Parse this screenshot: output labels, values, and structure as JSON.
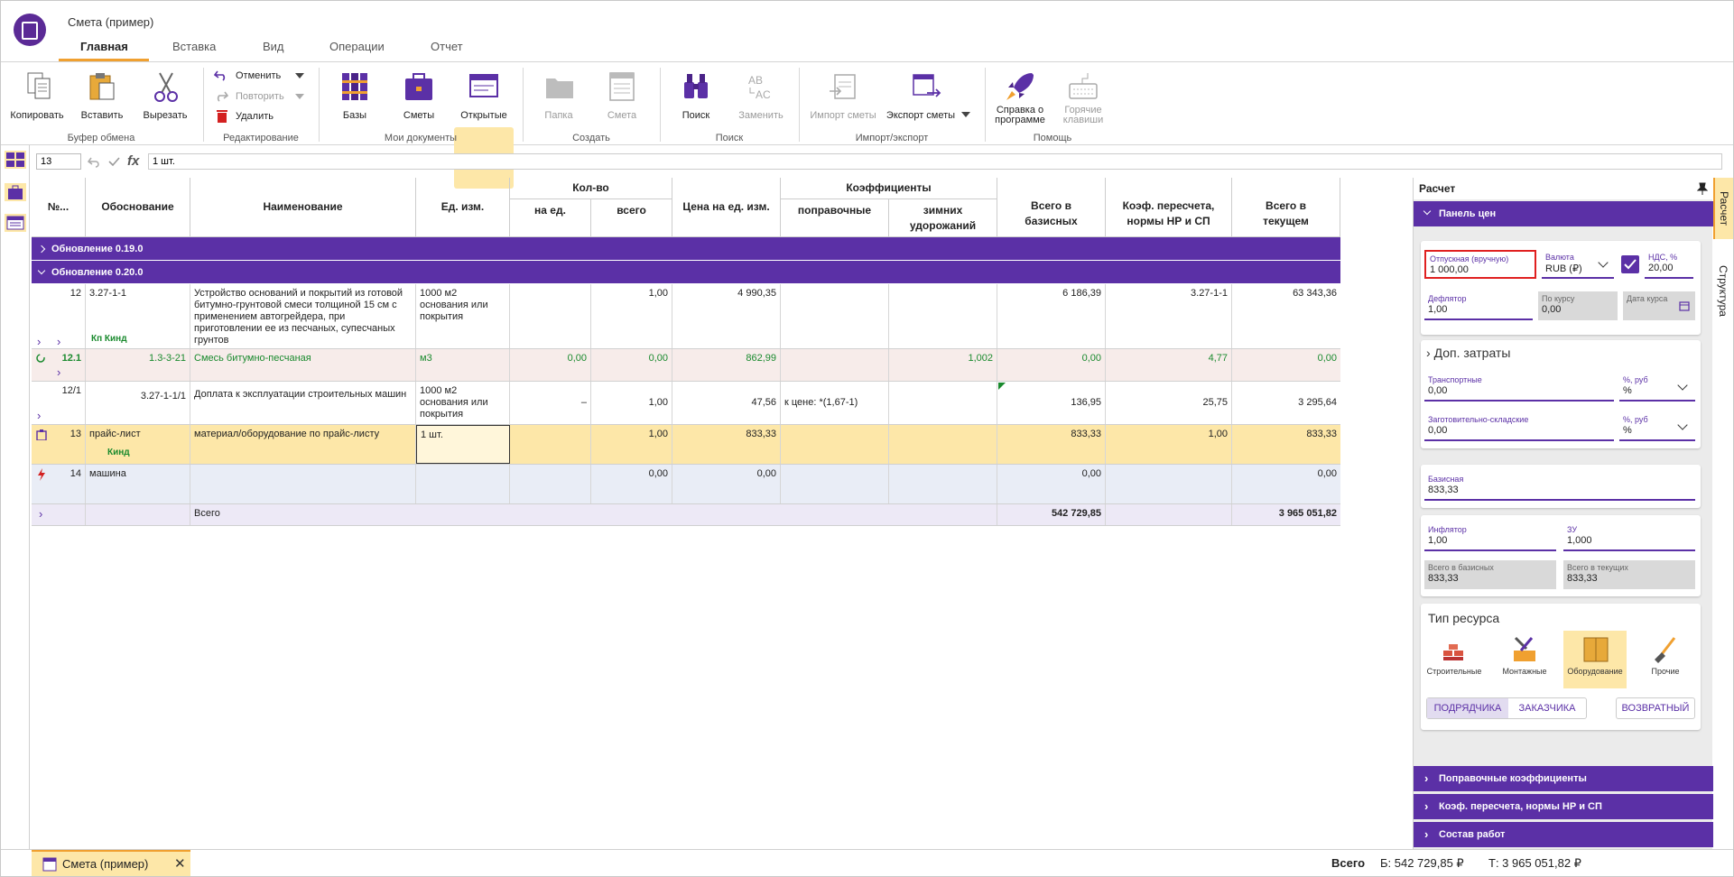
{
  "app": {
    "title": "Смета (пример)",
    "tabs": [
      "Главная",
      "Вставка",
      "Вид",
      "Операции",
      "Отчет"
    ]
  },
  "ribbon": {
    "clipboard": {
      "copy": "Копировать",
      "paste": "Вставить",
      "cut": "Вырезать",
      "group": "Буфер обмена"
    },
    "edit": {
      "undo": "Отменить",
      "redo": "Повторить",
      "delete": "Удалить",
      "group": "Редактирование"
    },
    "docs": {
      "bases": "Базы",
      "estimates": "Сметы",
      "open": "Открытые",
      "group": "Мои документы"
    },
    "create": {
      "folder": "Папка",
      "estimate": "Смета",
      "group": "Создать"
    },
    "search": {
      "search": "Поиск",
      "replace": "Заменить",
      "group": "Поиск"
    },
    "io": {
      "import": "Импорт сметы",
      "export": "Экспорт сметы",
      "group": "Импорт/экспорт"
    },
    "help": {
      "about": "Справка о программе",
      "hotkeys": "Горячие клавиши",
      "group": "Помощь"
    }
  },
  "formula": {
    "cell": "13",
    "value": "1 шт."
  },
  "grid": {
    "headers": {
      "num": "№...",
      "basis": "Обоснование",
      "name": "Наименование",
      "unit": "Ед. изм.",
      "qty": "Кол-во",
      "qty_per": "на ед.",
      "qty_total": "всего",
      "price": "Цена на ед. изм.",
      "coefs": "Коэффициенты",
      "coef_corr": "поправочные",
      "coef_winter": "зимних удорожаний",
      "total_base": "Всего в базисных",
      "recalc": "Коэф. пересчета, нормы НР и СП",
      "total_cur": "Всего в текущем"
    },
    "groups": [
      "Обновление 0.19.0",
      "Обновление 0.20.0"
    ],
    "rows": [
      {
        "num": "12",
        "basis": "3.27-1-1",
        "k": "Кп Кинд",
        "name": "Устройство оснований и покрытий из готовой битумно-грунтовой смеси толщиной 15 см с применением автогрейдера, при приготовлении ее из песчаных, супесчаных грунтов",
        "unit": "1000 м2 основания или покрытия",
        "qty_per": "",
        "qty_total": "1,00",
        "price": "4 990,35",
        "corr": "",
        "winter": "",
        "base": "6 186,39",
        "recalc": "3.27-1-1",
        "cur": "63 343,36"
      },
      {
        "num": "12.1",
        "basis": "1.3-3-21",
        "name": "Смесь битумно-песчаная",
        "unit": "м3",
        "qty_per": "0,00",
        "qty_total": "0,00",
        "price": "862,99",
        "corr": "",
        "winter": "1,002",
        "base": "0,00",
        "recalc": "4,77",
        "cur": "0,00"
      },
      {
        "num": "12/1",
        "basis": "3.27-1-1/1",
        "name": "Доплата к эксплуатации строительных машин",
        "unit": "1000 м2 основания или покрытия",
        "qty_per": "–",
        "qty_total": "1,00",
        "price": "47,56",
        "corr": "к цене: *(1,67-1)",
        "winter": "",
        "base": "136,95",
        "recalc": "25,75",
        "cur": "3 295,64"
      },
      {
        "num": "13",
        "basis": "прайс-лист",
        "k": "Кинд",
        "name": "материал/оборудование по прайс-листу",
        "unit": "1 шт.",
        "qty_per": "",
        "qty_total": "1,00",
        "price": "833,33",
        "corr": "",
        "winter": "",
        "base": "833,33",
        "recalc": "1,00",
        "cur": "833,33"
      },
      {
        "num": "14",
        "basis": "машина",
        "name": "",
        "unit": "",
        "qty_per": "",
        "qty_total": "0,00",
        "price": "0,00",
        "corr": "",
        "winter": "",
        "base": "0,00",
        "recalc": "",
        "cur": "0,00"
      }
    ],
    "total": {
      "label": "Всего",
      "base": "542 729,85",
      "cur": "3 965 051,82"
    }
  },
  "panel": {
    "title": "Расчет",
    "prices_header": "Панель цен",
    "release": {
      "label": "Отпускная (вручную)",
      "value": "1 000,00"
    },
    "currency": {
      "label": "Валюта",
      "value": "RUB (₽)"
    },
    "vat": {
      "label": "НДС, %",
      "value": "20,00"
    },
    "deflator": {
      "label": "Дефлятор",
      "value": "1,00"
    },
    "rate": {
      "label": "По курсу",
      "value": "0,00"
    },
    "rate_date": {
      "label": "Дата курса"
    },
    "extra": "Доп. затраты",
    "transport": {
      "label": "Транспортные",
      "value": "0,00"
    },
    "transport_unit": {
      "label": "%, руб",
      "value": "%"
    },
    "storage": {
      "label": "Заготовительно-складские",
      "value": "0,00"
    },
    "storage_unit": {
      "label": "%, руб",
      "value": "%"
    },
    "basic": {
      "label": "Базисная",
      "value": "833,33"
    },
    "inflator": {
      "label": "Инфлятор",
      "value": "1,00"
    },
    "zu": {
      "label": "ЗУ",
      "value": "1,000"
    },
    "tot_base": {
      "label": "Всего в базисных",
      "value": "833,33"
    },
    "tot_cur": {
      "label": "Всего в текущих",
      "value": "833,33"
    },
    "res_type": "Тип ресурса",
    "res": [
      "Строительные",
      "Монтажные",
      "Оборудование",
      "Прочие"
    ],
    "btns": [
      "ПОДРЯДЧИКА",
      "ЗАКАЗЧИКА",
      "ВОЗВРАТНЫЙ"
    ],
    "sections": [
      "Поправочные коэффициенты",
      "Коэф. пересчета, нормы НР и СП",
      "Состав работ"
    ],
    "vtabs": [
      "Расчет",
      "Структура"
    ]
  },
  "footer": {
    "doc": "Смета (пример)",
    "total_label": "Всего",
    "base": "Б: 542 729,85 ₽",
    "cur": "Т: 3 965 051,82 ₽"
  },
  "colors": {
    "accent": "#5b30a6",
    "highlight": "#fde7a8",
    "brand": "#f0a030"
  }
}
